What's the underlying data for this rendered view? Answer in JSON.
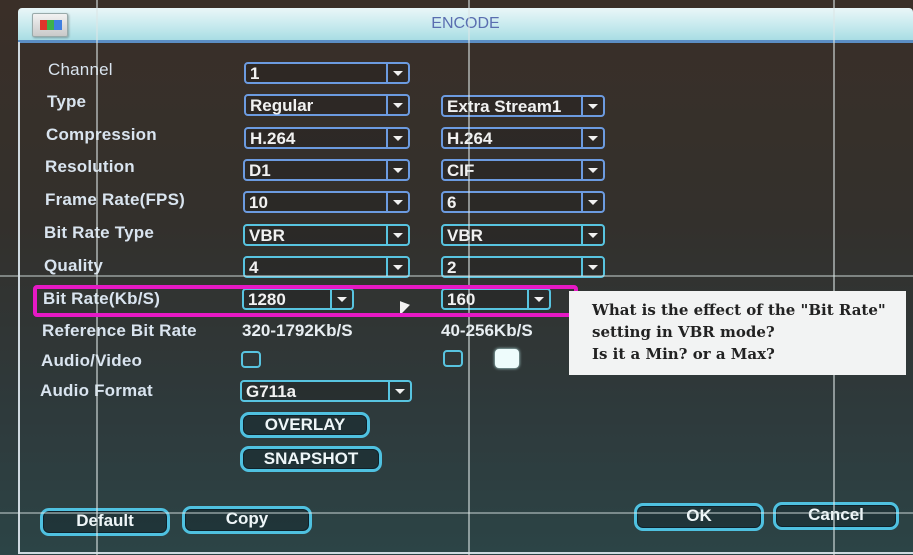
{
  "window": {
    "title": "ENCODE",
    "icon": "color-bars-icon"
  },
  "rows": [
    {
      "label": "Channel",
      "main": "1",
      "extra": null
    },
    {
      "label": "Type",
      "main": "Regular",
      "extra": "Extra Stream1"
    },
    {
      "label": "Compression",
      "main": "H.264",
      "extra": "H.264"
    },
    {
      "label": "Resolution",
      "main": "D1",
      "extra": "CIF"
    },
    {
      "label": "Frame Rate(FPS)",
      "main": "10",
      "extra": "6"
    },
    {
      "label": "Bit Rate Type",
      "main": "VBR",
      "extra": "VBR"
    },
    {
      "label": "Quality",
      "main": "4",
      "extra": "2"
    },
    {
      "label": "Bit Rate(Kb/S)",
      "main": "1280",
      "extra": "160"
    }
  ],
  "reference": {
    "label": "Reference Bit Rate",
    "main": "320-1792Kb/S",
    "extra": "40-256Kb/S"
  },
  "audio_video": {
    "label": "Audio/Video",
    "main_checked": false,
    "extra_checked": false,
    "extra_second_checked": true
  },
  "audio_format": {
    "label": "Audio Format",
    "value": "G711a"
  },
  "buttons": {
    "overlay": "OVERLAY",
    "snapshot": "SNAPSHOT",
    "default": "Default",
    "copy": "Copy",
    "ok": "OK",
    "cancel": "Cancel"
  },
  "annotation": {
    "highlight_color": "#e619c5",
    "lines": [
      "What is the effect of the \"Bit Rate\"",
      "setting in VBR mode?",
      "Is it a Min? or a Max?"
    ]
  }
}
